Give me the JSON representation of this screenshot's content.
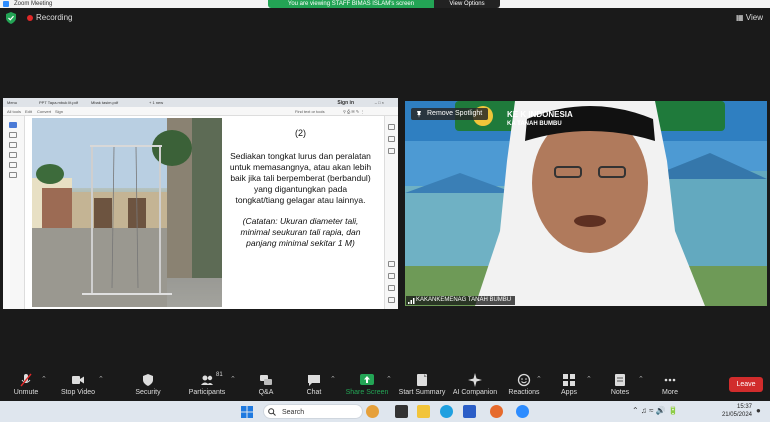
{
  "window": {
    "title": "Zoom Meeting"
  },
  "top": {
    "recording_label": "Recording",
    "viewing_banner": "You are viewing STAFF BIMAS ISLAM's screen",
    "view_options_label": "View Options",
    "view_label": "View"
  },
  "pdf": {
    "tabs": [
      "Menu",
      "PPT Tapa.mbuk lit.pdf",
      "Mbak tasim.pdf",
      "+ 1 new"
    ],
    "signin_label": "Sign in",
    "toolbar": [
      "All tools",
      "Edit",
      "Convert",
      "Sign"
    ],
    "find_label": "Find text or tools"
  },
  "slide": {
    "number": "(2)",
    "body": "Sediakan tongkat lurus dan peralatan untuk memasangnya, atau akan lebih baik jika tali berpemberat (berbandul) yang digantungkan pada tongkat/tiang gelagar atau lainnya.",
    "note": "(Catatan: Ukuran diameter tali, minimal seukuran tali rapia, dan panjang minimal sekitar 1 M)"
  },
  "video": {
    "remove_spotlight_label": "Remove Spotlight",
    "participant_name": "KAKANKEMENAG TANAH BUMBU",
    "banner_line1": "KE          K INDONESIA",
    "banner_line2": "KA          TANAH BUMBU"
  },
  "toolbar": {
    "unmute": "Unmute",
    "stop_video": "Stop Video",
    "security": "Security",
    "participants": "Participants",
    "participants_count": "81",
    "qa": "Q&A",
    "chat": "Chat",
    "share_screen": "Share Screen",
    "start_summary": "Start Summary",
    "ai_companion": "AI Companion",
    "reactions": "Reactions",
    "apps": "Apps",
    "notes": "Notes",
    "more": "More",
    "leave": "Leave"
  },
  "taskbar": {
    "search_placeholder": "Search",
    "time": "15:37",
    "date": "21/05/2024"
  },
  "colors": {
    "green": "#23a455",
    "record_red": "#e02828",
    "leave_red": "#d12c2c",
    "zoom_blue": "#2d8cff"
  }
}
